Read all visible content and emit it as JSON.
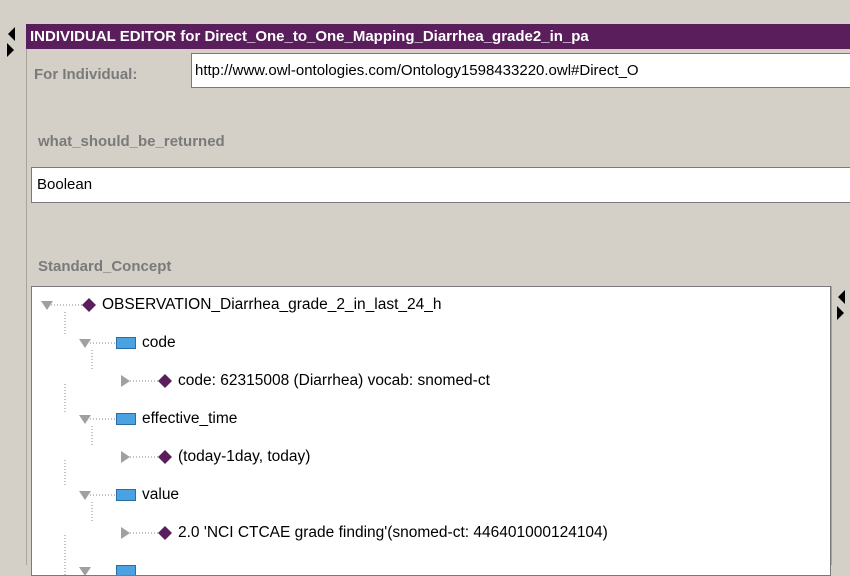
{
  "editor": {
    "title": "INDIVIDUAL EDITOR for Direct_One_to_One_Mapping_Diarrhea_grade2_in_pa",
    "for_label": "For Individual:",
    "for_value": "http://www.owl-ontologies.com/Ontology1598433220.owl#Direct_O"
  },
  "properties": {
    "what_label": "what_should_be_returned",
    "what_value": "Boolean",
    "standard_label": "Standard_Concept"
  },
  "tree": {
    "root": "OBSERVATION_Diarrhea_grade_2_in_last_24_h",
    "code": "code",
    "code_value": "code: 62315008 (Diarrhea) vocab: snomed-ct",
    "effective_time": "effective_time",
    "effective_time_value": "(today-1day, today)",
    "value": "value",
    "value_value": "2.0 'NCI CTCAE grade finding'(snomed-ct: 446401000124104)"
  },
  "colors": {
    "title_bg": "#5a1e5c",
    "diamond": "#5a1e5c",
    "slot_box": "#4aa3e0"
  }
}
